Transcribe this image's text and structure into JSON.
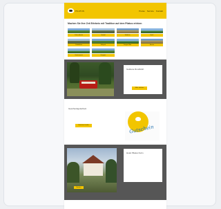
{
  "header": {
    "logo_icon": "mountain-train-icon",
    "logo_text": "PILATUS",
    "nav": [
      "Preise",
      "Service",
      "Kontakt"
    ],
    "brand_color": "#f2c500"
  },
  "intro": {
    "title": "Machen Sie Ihre Zeit Erlebnis mit Tradition auf dem Pilatus erleben"
  },
  "tiles": [
    {
      "label": "Zahnradbahn"
    },
    {
      "label": "Gondel"
    },
    {
      "label": "Seilbahn"
    },
    {
      "label": "Hotel"
    },
    {
      "label": "Rodelbahn"
    },
    {
      "label": "Seilpark"
    },
    {
      "label": "Dragon Ride"
    },
    {
      "label": "Events"
    },
    {
      "label": "Gastronomie"
    },
    {
      "label": "Gruppen"
    }
  ],
  "promo1": {
    "title": "Goldene Rundfahrt",
    "button": "Mehr erfahren"
  },
  "gift": {
    "title": "Geschenkgutschein",
    "button": "Gutschein kaufen",
    "script": "Gutschein"
  },
  "promo2": {
    "title": "Hotel Pilatus Kulm",
    "button": "Buchen"
  }
}
